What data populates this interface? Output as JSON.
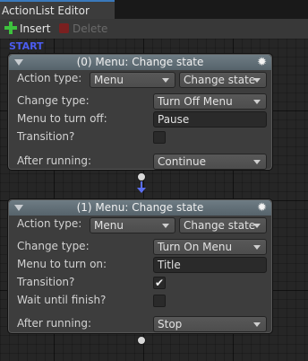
{
  "window": {
    "tab_title": "ActionList Editor"
  },
  "toolbar": {
    "insert_label": "Insert",
    "delete_label": "Delete"
  },
  "canvas": {
    "start_label": "START"
  },
  "nodes": [
    {
      "title": "(0) Menu: Change state",
      "action_type_label": "Action type:",
      "action_category": "Menu",
      "action_name": "Change state",
      "change_type_label": "Change type:",
      "change_type_value": "Turn Off Menu",
      "menu_label": "Menu to turn off:",
      "menu_value": "Pause",
      "transition_label": "Transition?",
      "transition_checked": false,
      "after_running_label": "After running:",
      "after_running_value": "Continue"
    },
    {
      "title": "(1) Menu: Change state",
      "action_type_label": "Action type:",
      "action_category": "Menu",
      "action_name": "Change state",
      "change_type_label": "Change type:",
      "change_type_value": "Turn On Menu",
      "menu_label": "Menu to turn on:",
      "menu_value": "Title",
      "transition_label": "Transition?",
      "transition_checked": true,
      "transition_check_glyph": "✔",
      "wait_label": "Wait until finish?",
      "wait_checked": false,
      "after_running_label": "After running:",
      "after_running_value": "Stop"
    }
  ],
  "colors": {
    "accent": "#3a79bb",
    "link": "#5a6ef2",
    "start": "#4b5cf0",
    "insert": "#3ec23e",
    "delete": "#7a2020"
  },
  "icons": {
    "insert": "plus-icon",
    "delete": "x-icon",
    "node_options": "gear-icon",
    "fold": "triangle-down-icon",
    "checkbox": "checkmark-icon"
  }
}
